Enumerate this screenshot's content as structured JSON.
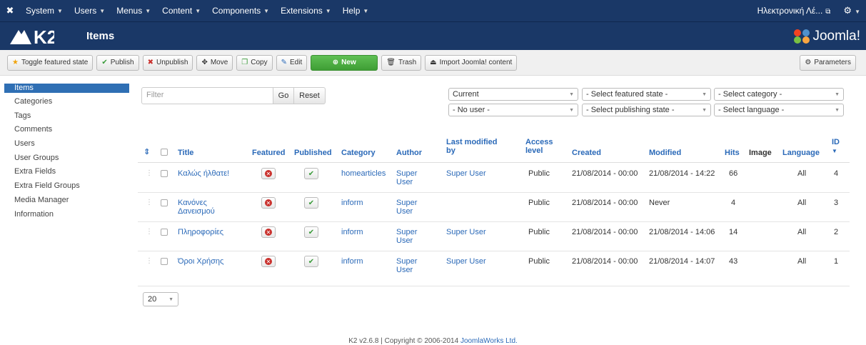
{
  "topnav": {
    "menus": [
      {
        "label": "System"
      },
      {
        "label": "Users"
      },
      {
        "label": "Menus"
      },
      {
        "label": "Content"
      },
      {
        "label": "Components"
      },
      {
        "label": "Extensions"
      },
      {
        "label": "Help"
      }
    ],
    "site_link": "Ηλεκτρονική Λέ..."
  },
  "header": {
    "logo_text": "K2",
    "title": "Items",
    "joomla_logo": "Joomla!"
  },
  "toolbar": {
    "toggle_featured": "Toggle featured state",
    "publish": "Publish",
    "unpublish": "Unpublish",
    "move": "Move",
    "copy": "Copy",
    "edit": "Edit",
    "new": "New",
    "trash": "Trash",
    "import": "Import Joomla! content",
    "parameters": "Parameters"
  },
  "sidebar": {
    "items": [
      {
        "label": "Items",
        "active": true
      },
      {
        "label": "Categories"
      },
      {
        "label": "Tags"
      },
      {
        "label": "Comments"
      },
      {
        "label": "Users"
      },
      {
        "label": "User Groups"
      },
      {
        "label": "Extra Fields"
      },
      {
        "label": "Extra Field Groups"
      },
      {
        "label": "Media Manager"
      },
      {
        "label": "Information"
      }
    ]
  },
  "filters": {
    "search_placeholder": "Filter",
    "go": "Go",
    "reset": "Reset",
    "trash_state": "Current",
    "featured_state": "- Select featured state -",
    "category": "- Select category -",
    "user": "- No user -",
    "publishing_state": "- Select publishing state -",
    "language": "- Select language -"
  },
  "table": {
    "headers": {
      "sort": "⇕",
      "title": "Title",
      "featured": "Featured",
      "published": "Published",
      "category": "Category",
      "author": "Author",
      "last_modified_by_1": "Last modified",
      "last_modified_by_2": "by",
      "access_1": "Access",
      "access_2": "level",
      "created": "Created",
      "modified": "Modified",
      "hits": "Hits",
      "image": "Image",
      "language": "Language",
      "id": "ID"
    },
    "rows": [
      {
        "title_1": "Καλώς ήλθατε!",
        "title_2": "",
        "category": "homearticles",
        "author_1": "Super",
        "author_2": "User",
        "modified_by": "Super User",
        "access": "Public",
        "created": "21/08/2014 - 00:00",
        "modified": "21/08/2014 - 14:22",
        "hits": "66",
        "language": "All",
        "id": "4"
      },
      {
        "title_1": "Κανόνες",
        "title_2": "Δανεισμού",
        "category": "inform",
        "author_1": "Super",
        "author_2": "User",
        "modified_by": "",
        "access": "Public",
        "created": "21/08/2014 - 00:00",
        "modified": "Never",
        "hits": "4",
        "language": "All",
        "id": "3"
      },
      {
        "title_1": "Πληροφορίες",
        "title_2": "",
        "category": "inform",
        "author_1": "Super",
        "author_2": "User",
        "modified_by": "Super User",
        "access": "Public",
        "created": "21/08/2014 - 00:00",
        "modified": "21/08/2014 - 14:06",
        "hits": "14",
        "language": "All",
        "id": "2"
      },
      {
        "title_1": "Όροι Χρήσης",
        "title_2": "",
        "category": "inform",
        "author_1": "Super",
        "author_2": "User",
        "modified_by": "Super User",
        "access": "Public",
        "created": "21/08/2014 - 00:00",
        "modified": "21/08/2014 - 14:07",
        "hits": "43",
        "language": "All",
        "id": "1"
      }
    ]
  },
  "pagination": {
    "limit": "20"
  },
  "footer": {
    "text": "K2 v2.6.8 | Copyright © 2006-2014 ",
    "link": "JoomlaWorks Ltd."
  }
}
